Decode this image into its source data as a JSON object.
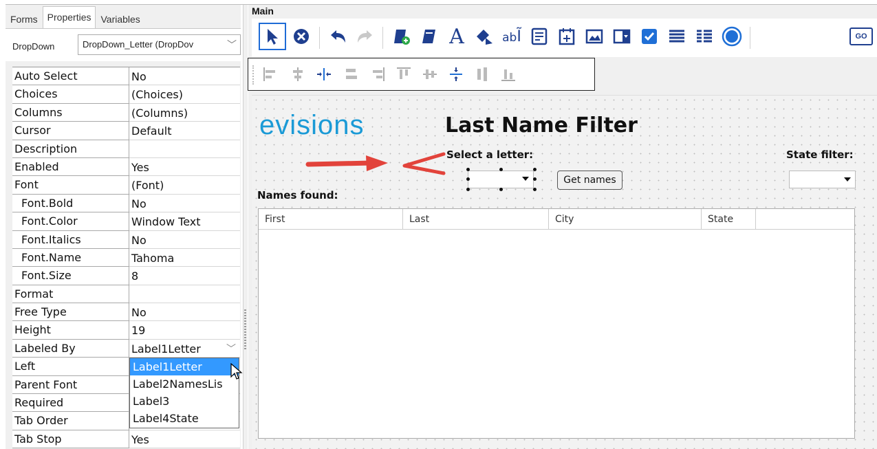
{
  "tabs": [
    {
      "label": "Forms"
    },
    {
      "label": "Properties"
    },
    {
      "label": "Variables"
    }
  ],
  "object_selector": {
    "label": "DropDown",
    "value": "DropDown_Letter (DropDov"
  },
  "properties": [
    {
      "name": "Auto Select",
      "value": "No"
    },
    {
      "name": "Choices",
      "value": "(Choices)"
    },
    {
      "name": "Columns",
      "value": "(Columns)"
    },
    {
      "name": "Cursor",
      "value": "Default"
    },
    {
      "name": "Description",
      "value": ""
    },
    {
      "name": "Enabled",
      "value": "Yes"
    },
    {
      "name": "Font",
      "value": "(Font)"
    },
    {
      "name": "Font.Bold",
      "value": "No"
    },
    {
      "name": "Font.Color",
      "value": "Window Text"
    },
    {
      "name": "Font.Italics",
      "value": "No"
    },
    {
      "name": "Font.Name",
      "value": "Tahoma"
    },
    {
      "name": "Font.Size",
      "value": "8"
    },
    {
      "name": "Format",
      "value": ""
    },
    {
      "name": "Free Type",
      "value": "No"
    },
    {
      "name": "Height",
      "value": "19"
    },
    {
      "name": "Labeled By",
      "value": "Label1Letter"
    },
    {
      "name": "Left",
      "value": ""
    },
    {
      "name": "Parent Font",
      "value": ""
    },
    {
      "name": "Required",
      "value": ""
    },
    {
      "name": "Tab Order",
      "value": ""
    },
    {
      "name": "Tab Stop",
      "value": "Yes"
    }
  ],
  "labeled_by_options": [
    "Label1Letter",
    "Label2NamesLis",
    "Label3",
    "Label4State"
  ],
  "labeled_by_selected": "Label1Letter",
  "main": {
    "label": "Main",
    "toolbar_icons": [
      "pointer-icon",
      "delete-icon",
      "undo-icon",
      "redo-icon",
      "new-form-icon",
      "form-icon",
      "text-label-icon",
      "shape-icon",
      "textbox-icon",
      "memo-icon",
      "date-icon",
      "image-icon",
      "dropdown-icon",
      "checkbox-icon",
      "list-icon",
      "grid-icon",
      "radio-icon",
      "go-icon"
    ],
    "go_label": "GO",
    "align_icons": [
      "align-left-icon",
      "align-center-h-icon",
      "center-horizontal-icon",
      "distribute-h-icon",
      "align-right-icon",
      "align-top-icon",
      "align-middle-icon",
      "center-vertical-icon",
      "distribute-v-icon",
      "align-bottom-icon"
    ]
  },
  "form": {
    "logo": "evisions",
    "title": "Last Name Filter",
    "select_letter_label": "Select a letter:",
    "state_filter_label": "State filter:",
    "names_found_label": "Names found:",
    "get_names_button": "Get names",
    "columns": [
      "First",
      "Last",
      "City",
      "State"
    ]
  },
  "colors": {
    "selection": "#3399ff",
    "logo": "#1b9ad6",
    "annotation_arrow": "#e2433b",
    "toolbar_icon": "#1f3f8f"
  }
}
